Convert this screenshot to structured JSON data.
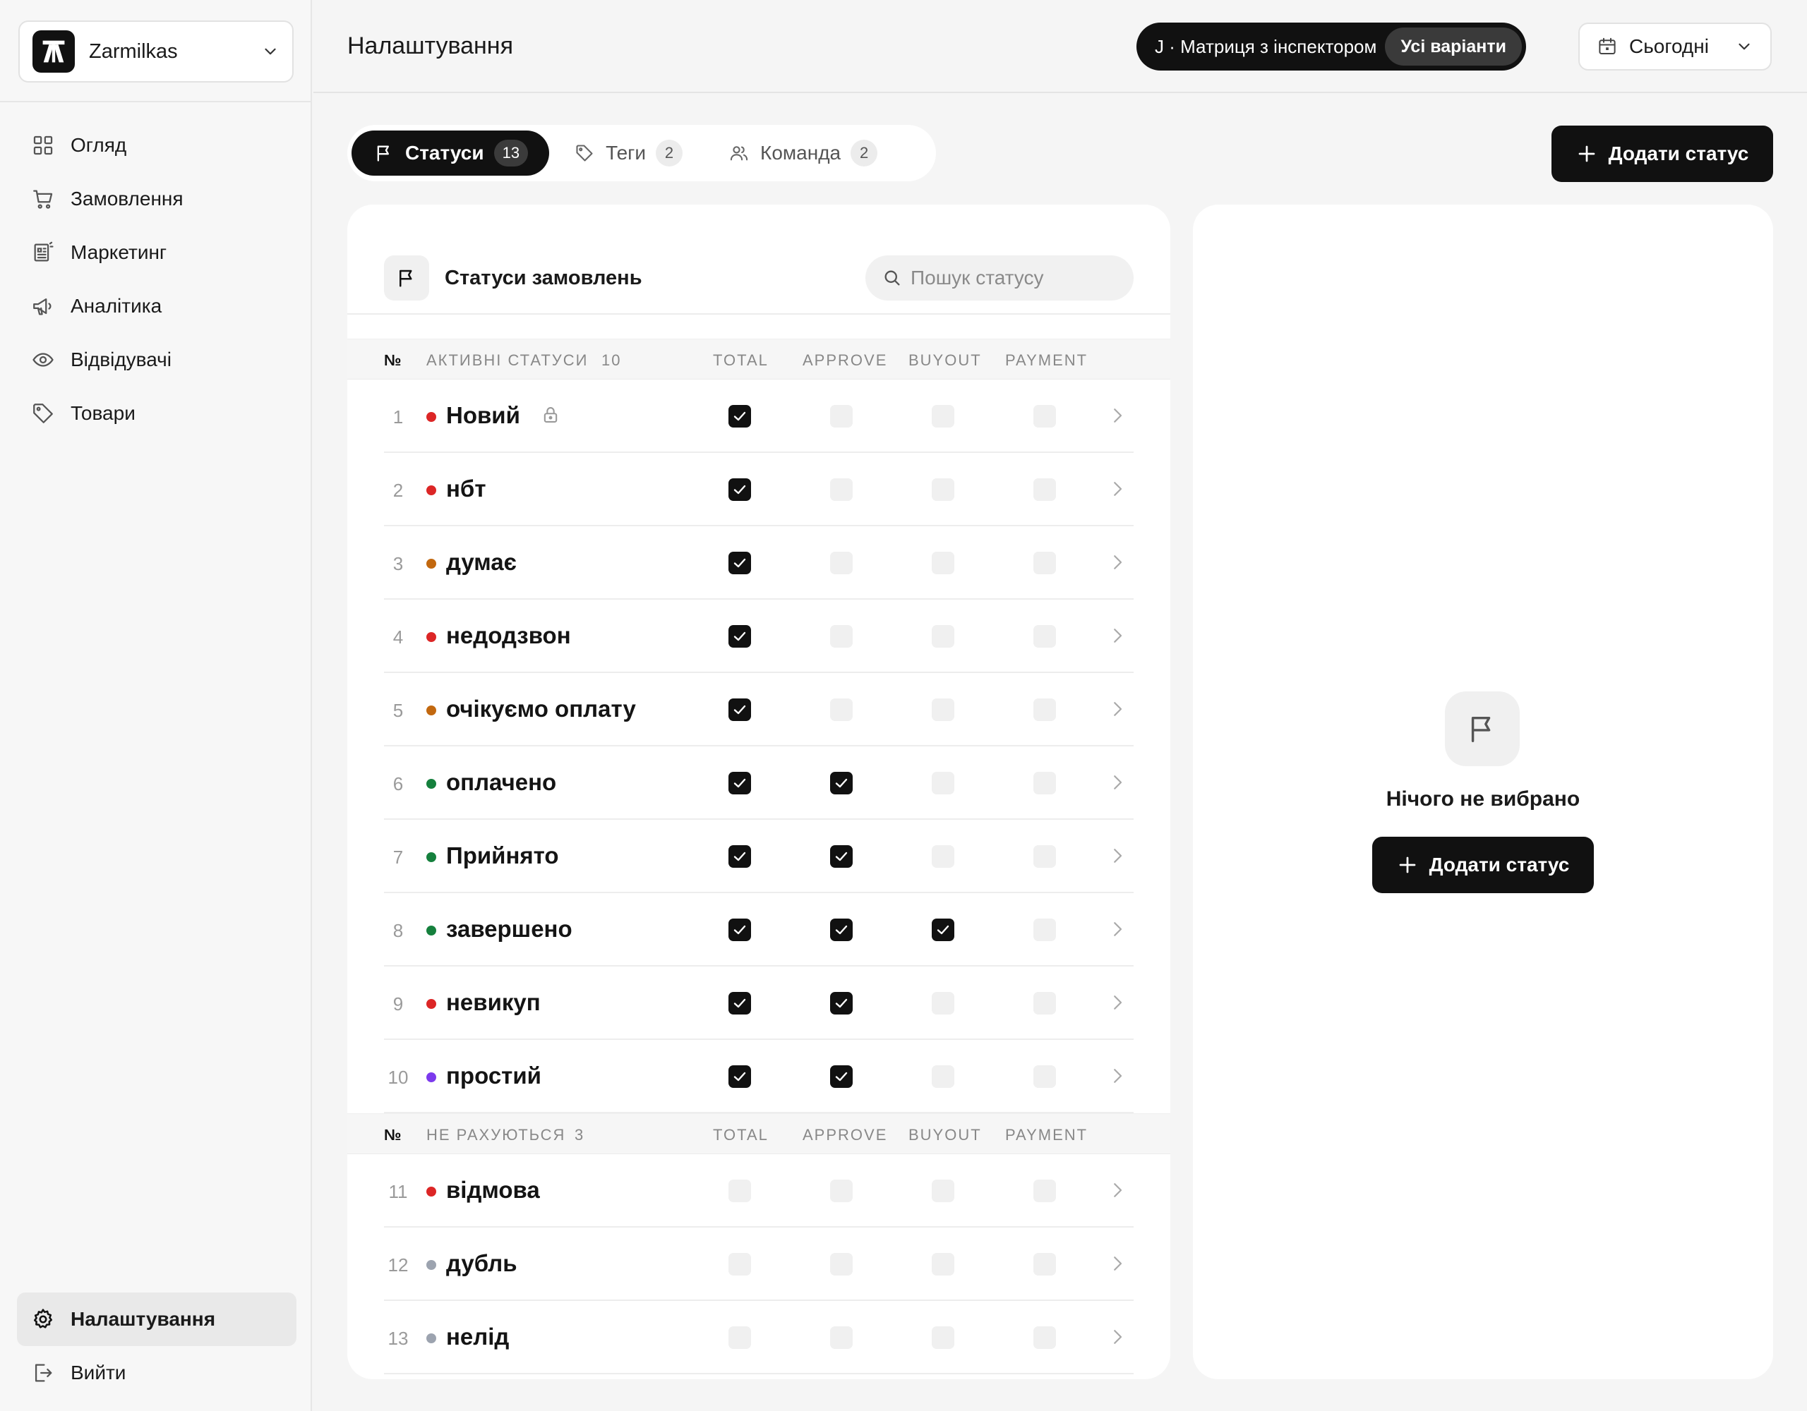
{
  "app": {
    "workspace": "Zarmilkas",
    "page_title": "Налаштування"
  },
  "sidebar": {
    "items": [
      {
        "label": "Огляд",
        "icon": "grid-icon"
      },
      {
        "label": "Замовлення",
        "icon": "cart-icon"
      },
      {
        "label": "Маркетинг",
        "icon": "newspaper-icon"
      },
      {
        "label": "Аналітика",
        "icon": "megaphone-icon"
      },
      {
        "label": "Відвідувачі",
        "icon": "eye-icon"
      },
      {
        "label": "Товари",
        "icon": "tag-icon"
      }
    ],
    "settings_label": "Налаштування",
    "logout_label": "Вийти"
  },
  "header": {
    "variant_text": "J · Матриця з інспектором",
    "variant_button": "Усі варіанти",
    "date_label": "Сьогодні"
  },
  "tabs": [
    {
      "label": "Статуси",
      "count": "13",
      "active": true
    },
    {
      "label": "Теги",
      "count": "2",
      "active": false
    },
    {
      "label": "Команда",
      "count": "2",
      "active": false
    }
  ],
  "add_status_label": "Додати статус",
  "statuses_card": {
    "title": "Статуси замовлень",
    "search_placeholder": "Пошук статусу",
    "columns": [
      "TOTAL",
      "APPROVE",
      "BUYOUT",
      "PAYMENT"
    ],
    "num_header": "№",
    "sections": [
      {
        "title": "АКТИВНІ СТАТУСИ",
        "count": "10",
        "rows": [
          {
            "index": "1",
            "name": "Новий",
            "color": "#dc2626",
            "locked": true,
            "checks": [
              true,
              false,
              false,
              false
            ]
          },
          {
            "index": "2",
            "name": "нбт",
            "color": "#dc2626",
            "locked": false,
            "checks": [
              true,
              false,
              false,
              false
            ]
          },
          {
            "index": "3",
            "name": "думає",
            "color": "#c2680f",
            "locked": false,
            "checks": [
              true,
              false,
              false,
              false
            ]
          },
          {
            "index": "4",
            "name": "недодзвон",
            "color": "#dc2626",
            "locked": false,
            "checks": [
              true,
              false,
              false,
              false
            ]
          },
          {
            "index": "5",
            "name": "очікуємо оплату",
            "color": "#c2680f",
            "locked": false,
            "checks": [
              true,
              false,
              false,
              false
            ]
          },
          {
            "index": "6",
            "name": "оплачено",
            "color": "#15803d",
            "locked": false,
            "checks": [
              true,
              true,
              false,
              false
            ]
          },
          {
            "index": "7",
            "name": "Прийнято",
            "color": "#15803d",
            "locked": false,
            "checks": [
              true,
              true,
              false,
              false
            ]
          },
          {
            "index": "8",
            "name": "завершено",
            "color": "#15803d",
            "locked": false,
            "checks": [
              true,
              true,
              true,
              false
            ]
          },
          {
            "index": "9",
            "name": "невикуп",
            "color": "#dc2626",
            "locked": false,
            "checks": [
              true,
              true,
              false,
              false
            ]
          },
          {
            "index": "10",
            "name": "простий",
            "color": "#7c3aed",
            "locked": false,
            "checks": [
              true,
              true,
              false,
              false
            ]
          }
        ]
      },
      {
        "title": "НЕ РАХУЮТЬСЯ",
        "count": "3",
        "rows": [
          {
            "index": "11",
            "name": "відмова",
            "color": "#dc2626",
            "locked": false,
            "checks": [
              false,
              false,
              false,
              false
            ]
          },
          {
            "index": "12",
            "name": "дубль",
            "color": "#9ca3af",
            "locked": false,
            "checks": [
              false,
              false,
              false,
              false
            ]
          },
          {
            "index": "13",
            "name": "нелід",
            "color": "#9ca3af",
            "locked": false,
            "checks": [
              false,
              false,
              false,
              false
            ]
          }
        ]
      }
    ]
  },
  "inspector": {
    "empty_text": "Нічого не вибрано",
    "add_label": "Додати статус"
  }
}
